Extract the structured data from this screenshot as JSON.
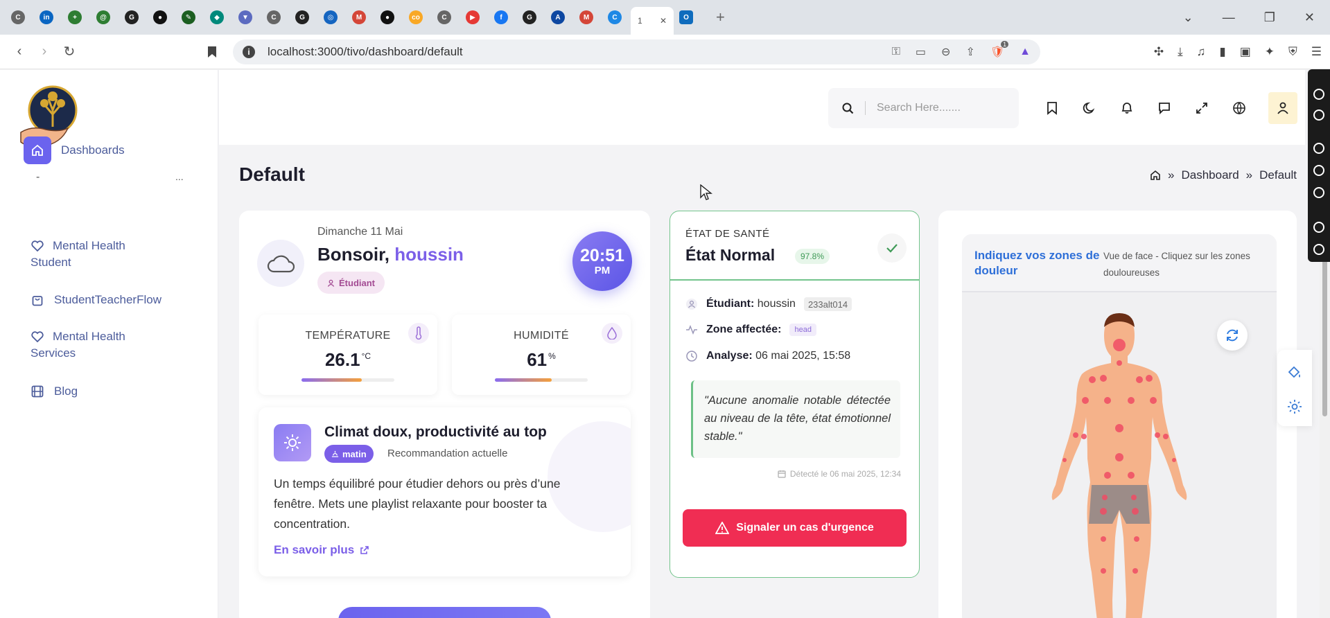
{
  "browser": {
    "tabs": [
      {
        "initial": "C",
        "color": "#666666"
      },
      {
        "initial": "in",
        "color": "#0a66c2"
      },
      {
        "initial": "+",
        "color": "#2e7d32"
      },
      {
        "initial": "@",
        "color": "#2e7d32"
      },
      {
        "initial": "G",
        "color": "#222222"
      },
      {
        "initial": "●",
        "color": "#111111"
      },
      {
        "initial": "✎",
        "color": "#1b5e20"
      },
      {
        "initial": "◆",
        "color": "#00897b"
      },
      {
        "initial": "▼",
        "color": "#5c6bc0"
      },
      {
        "initial": "C",
        "color": "#666666"
      },
      {
        "initial": "G",
        "color": "#222222"
      },
      {
        "initial": "◎",
        "color": "#1565c0"
      },
      {
        "initial": "M",
        "color": "#d44638"
      },
      {
        "initial": "●",
        "color": "#111111"
      },
      {
        "initial": "co",
        "color": "#f9a825"
      },
      {
        "initial": "C",
        "color": "#666666"
      },
      {
        "initial": "▶",
        "color": "#e53935"
      },
      {
        "initial": "f",
        "color": "#1877f2"
      },
      {
        "initial": "G",
        "color": "#222222"
      },
      {
        "initial": "A",
        "color": "#0d47a1"
      },
      {
        "initial": "M",
        "color": "#d44638"
      },
      {
        "initial": "C",
        "color": "#1e88e5"
      }
    ],
    "active_tab_label": "1",
    "last_tab_initial": "O",
    "url": "localhost:3000/tivo/dashboard/default",
    "extension_badge": "1"
  },
  "sidebar": {
    "dashboards": "Dashboards",
    "divider_left": "-",
    "divider_right": "...",
    "items": [
      {
        "label_line1": "Mental Health",
        "label_line2": "Student"
      },
      {
        "label_line1": "StudentTeacherFlow",
        "label_line2": ""
      },
      {
        "label_line1": "Mental Health",
        "label_line2": "Services"
      },
      {
        "label_line1": "Blog",
        "label_line2": ""
      }
    ]
  },
  "header": {
    "search_placeholder": "Search Here......."
  },
  "page": {
    "title": "Default",
    "breadcrumb": [
      "Dashboard",
      "Default"
    ]
  },
  "welcome": {
    "date": "Dimanche 11 Mai",
    "greeting": "Bonsoir,",
    "name": "houssin",
    "role": "Étudiant",
    "time": "20:51",
    "ampm": "PM"
  },
  "metrics": {
    "temperature": {
      "label": "TEMPÉRATURE",
      "value": "26.1",
      "unit": "°C",
      "fill": 0.65
    },
    "humidity": {
      "label": "HUMIDITÉ",
      "value": "61",
      "unit": "%",
      "fill": 0.61
    }
  },
  "recommendation": {
    "title": "Climat doux, productivité au top",
    "tag": "matin",
    "tag_desc": "Recommandation actuelle",
    "body": "Un temps équilibré pour étudier dehors ou près d’une fenêtre. Mets une playlist relaxante pour booster ta concentration.",
    "link": "En savoir plus"
  },
  "health": {
    "kicker": "ÉTAT DE SANTÉ",
    "state": "État Normal",
    "confidence": "97.8%",
    "student_label": "Étudiant:",
    "student_name": "houssin",
    "student_id": "233alt014",
    "zone_label": "Zone affectée:",
    "zone": "head",
    "analysis_label": "Analyse:",
    "analysis_date": "06 mai 2025, 15:58",
    "quote": "\"Aucune anomalie notable détectée au niveau de la tête, état émotionnel stable.\"",
    "detected": "Détecté le 06 mai 2025, 12:34",
    "urgent_button": "Signaler un cas d'urgence"
  },
  "pain_map": {
    "title": "Indiquez vos zones de douleur",
    "subtitle": "Vue de face - Cliquez sur les zones douloureuses"
  },
  "colors": {
    "accent": "#6b63ee",
    "purple_text": "#7b5fe8",
    "health_green": "#73c48c",
    "urgent_red": "#f02d53",
    "pain_point": "#f04c64"
  }
}
